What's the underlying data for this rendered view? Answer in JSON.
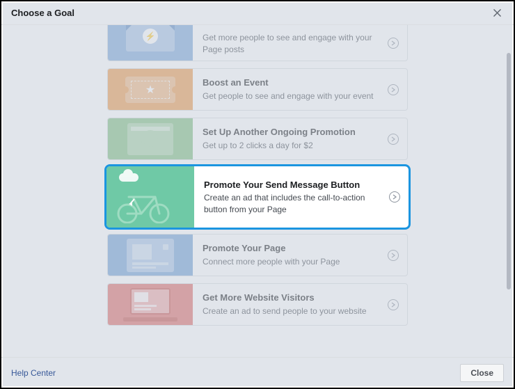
{
  "header": {
    "title": "Choose a Goal"
  },
  "goals": [
    {
      "title": "",
      "desc": "Get more people to see and engage with your Page posts"
    },
    {
      "title": "Boost an Event",
      "desc": "Get people to see and engage with your event"
    },
    {
      "title": "Set Up Another Ongoing Promotion",
      "desc": "Get up to 2 clicks a day for $2"
    },
    {
      "title": "Promote Your Send Message Button",
      "desc": "Create an ad that includes the call-to-action button from your Page"
    },
    {
      "title": "Promote Your Page",
      "desc": "Connect more people with your Page"
    },
    {
      "title": "Get More Website Visitors",
      "desc": "Create an ad to send people to your website"
    }
  ],
  "footer": {
    "help": "Help Center",
    "close": "Close"
  }
}
